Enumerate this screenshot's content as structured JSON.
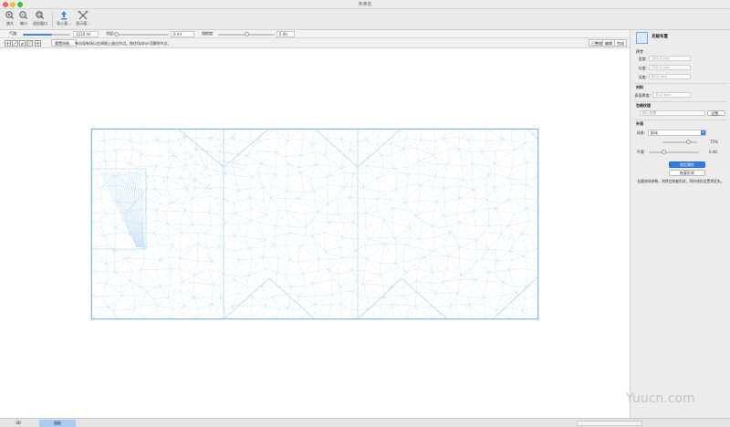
{
  "window": {
    "title": "未命名"
  },
  "toolbar": {
    "items": [
      {
        "label": "放大",
        "icon": "zoom-in-icon"
      },
      {
        "label": "缩小",
        "icon": "zoom-out-icon"
      },
      {
        "label": "适应窗口",
        "icon": "zoom-fit-icon"
      },
      {
        "label": "导入面...",
        "icon": "import-icon"
      },
      {
        "label": "显示面...",
        "icon": "tools-icon"
      }
    ]
  },
  "params": {
    "gas_label": "气路:",
    "gas_value": "1210 ml",
    "gas_fill": 0.62,
    "coat_label": "涂层:",
    "coat_value": "0 ml",
    "coat_fill": 0.0,
    "rough_label": "粗糙度:",
    "rough_value": "5.00",
    "rough_fill": 0.5
  },
  "tools": {
    "icons": [
      "move-icon",
      "pen-icon",
      "eraser-icon",
      "hatch-icon",
      "snap-icon"
    ],
    "hint_button": "重置网格...",
    "hint_text": "单击现有场以在网格上放出节点。按住Option可删除节点。",
    "view_buttons": [
      "已整理",
      "编辑",
      "完成"
    ]
  },
  "sidebar": {
    "title": "充能布置",
    "size_section": "尺寸",
    "width_label": "宽度:",
    "width_placeholder": "100.0 mm",
    "length_label": "长度:",
    "length_placeholder": "100.0 mm",
    "depth_label": "深度:",
    "depth_placeholder": "60.0 mm",
    "material_section": "材料",
    "material_label": "表面厚度:",
    "material_placeholder": "10.0 mm",
    "texture_section": "包装纹理",
    "texture_placeholder": "插入纹理",
    "texture_button": "设置...",
    "appearance_section": "外观",
    "style_label": "风格:",
    "style_value": "拟化",
    "opacity_value": "75%",
    "opacity_fill": 0.75,
    "smooth_label": "平滑:",
    "smooth_value": "0.40",
    "smooth_fill": 0.3,
    "primary_button": "锁定属性",
    "secondary_button": "恢复形状",
    "note": "若要修改参数，则将会恢复形状，同时成形设置将丢失。"
  },
  "bottom": {
    "tabs": [
      "3D",
      "面板"
    ],
    "active_tab": 1,
    "status": ""
  },
  "watermark": {
    "text": "Yuucn.com"
  }
}
